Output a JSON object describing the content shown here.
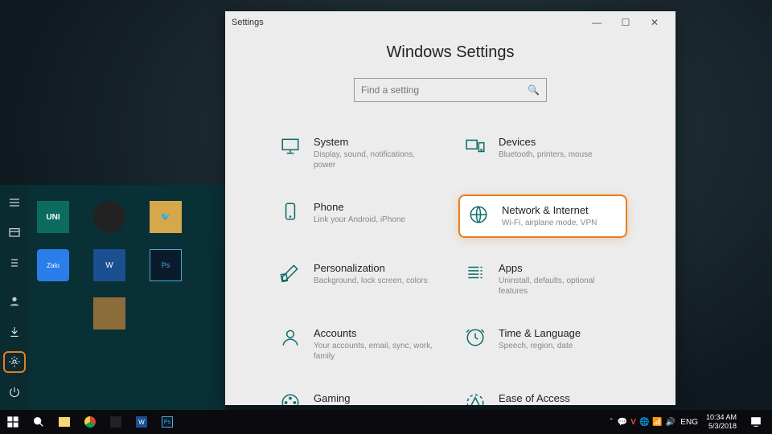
{
  "window": {
    "app_name": "Settings",
    "title": "Windows Settings",
    "search_placeholder": "Find a setting"
  },
  "categories": [
    {
      "name": "System",
      "desc": "Display, sound, notifications, power",
      "icon": "monitor"
    },
    {
      "name": "Devices",
      "desc": "Bluetooth, printers, mouse",
      "icon": "devices"
    },
    {
      "name": "Phone",
      "desc": "Link your Android, iPhone",
      "icon": "phone"
    },
    {
      "name": "Network & Internet",
      "desc": "Wi-Fi, airplane mode, VPN",
      "icon": "globe",
      "highlight": true
    },
    {
      "name": "Personalization",
      "desc": "Background, lock screen, colors",
      "icon": "pen"
    },
    {
      "name": "Apps",
      "desc": "Uninstall, defaults, optional features",
      "icon": "apps"
    },
    {
      "name": "Accounts",
      "desc": "Your accounts, email, sync, work, family",
      "icon": "person"
    },
    {
      "name": "Time & Language",
      "desc": "Speech, region, date",
      "icon": "time"
    },
    {
      "name": "Gaming",
      "desc": "",
      "icon": "gaming"
    },
    {
      "name": "Ease of Access",
      "desc": "",
      "icon": "ease"
    }
  ],
  "start_tiles": [
    {
      "label": "UNI",
      "cls": "uni"
    },
    {
      "label": "",
      "cls": "chrome"
    },
    {
      "label": "🐦",
      "cls": "bird"
    },
    {
      "label": "Zalo",
      "cls": "zalo"
    },
    {
      "label": "W",
      "cls": "word"
    },
    {
      "label": "Ps",
      "cls": "ps"
    },
    {
      "label": "",
      "cls": "misc"
    }
  ],
  "taskbar": {
    "lang": "ENG",
    "time": "10:34 AM",
    "date": "5/3/2018"
  }
}
